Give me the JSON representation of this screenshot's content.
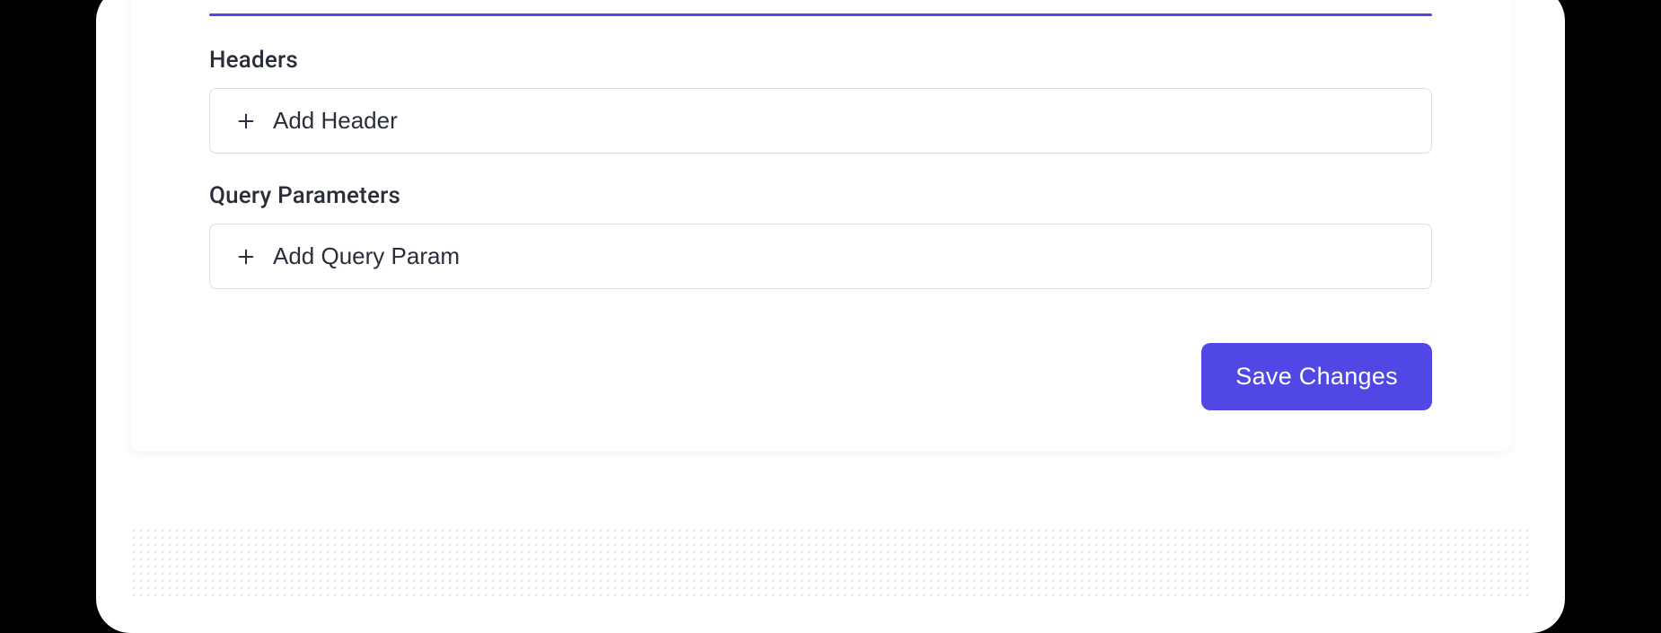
{
  "sections": {
    "headers": {
      "label": "Headers",
      "add_button_label": "Add Header"
    },
    "query_params": {
      "label": "Query Parameters",
      "add_button_label": "Add Query Param"
    }
  },
  "actions": {
    "save_label": "Save Changes"
  },
  "colors": {
    "accent": "#5147e4",
    "text_primary": "#2a2e3a",
    "border": "#dcdde1"
  }
}
